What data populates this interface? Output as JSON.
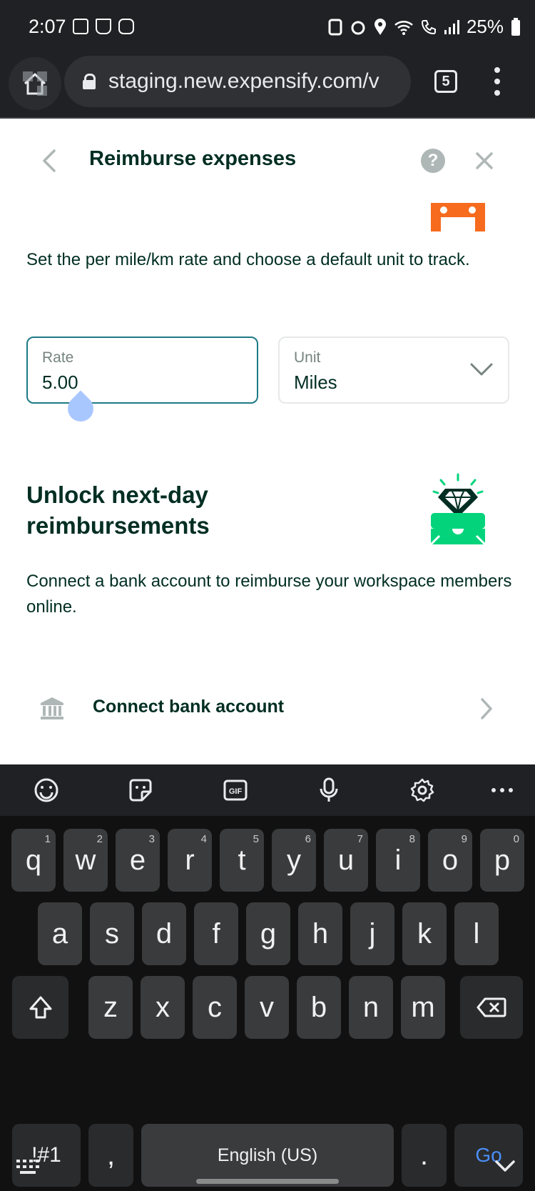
{
  "status_bar": {
    "time": "2:07",
    "battery": "25%"
  },
  "browser": {
    "url": "staging.new.expensify.com/v",
    "tab_count": "5"
  },
  "header": {
    "title": "Reimburse expenses"
  },
  "rate_section": {
    "description": "Set the per mile/km rate and choose a default unit to track.",
    "rate_label": "Rate",
    "rate_value": "5.00",
    "unit_label": "Unit",
    "unit_value": "Miles"
  },
  "unlock_section": {
    "heading_line1": "Unlock next-day",
    "heading_line2": "reimbursements",
    "description": "Connect a bank account to reimburse your workspace members online.",
    "connect_label": "Connect bank account"
  },
  "colors": {
    "accent_teal": "#1e7a86",
    "illustration_orange": "#f66b1d",
    "illustration_green": "#03d47c",
    "text_dark": "#002e22"
  },
  "keyboard": {
    "row1": [
      {
        "k": "q",
        "n": "1"
      },
      {
        "k": "w",
        "n": "2"
      },
      {
        "k": "e",
        "n": "3"
      },
      {
        "k": "r",
        "n": "4"
      },
      {
        "k": "t",
        "n": "5"
      },
      {
        "k": "y",
        "n": "6"
      },
      {
        "k": "u",
        "n": "7"
      },
      {
        "k": "i",
        "n": "8"
      },
      {
        "k": "o",
        "n": "9"
      },
      {
        "k": "p",
        "n": "0"
      }
    ],
    "row2": [
      "a",
      "s",
      "d",
      "f",
      "g",
      "h",
      "j",
      "k",
      "l"
    ],
    "row3": [
      "z",
      "x",
      "c",
      "v",
      "b",
      "n",
      "m"
    ],
    "symbols_label": "!#1",
    "comma_label": ",",
    "space_label": "English (US)",
    "period_label": ".",
    "go_label": "Go"
  }
}
